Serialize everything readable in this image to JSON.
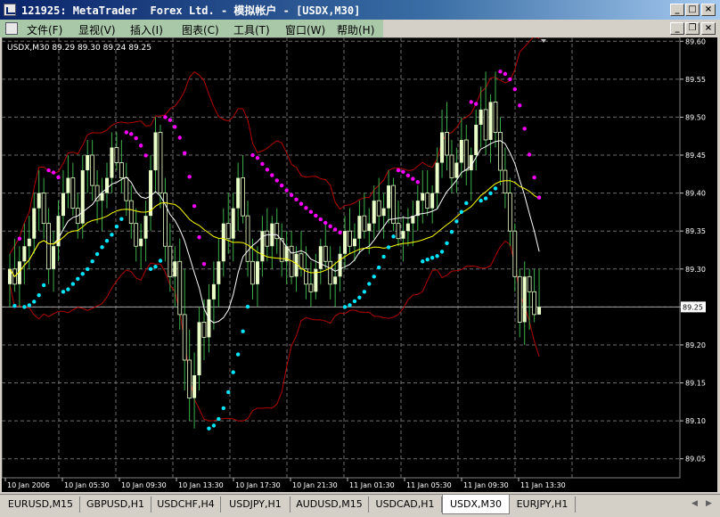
{
  "window": {
    "title": "121925: MetaTrader  Forex Ltd. - 模拟帐户 - [USDX,M30]"
  },
  "menu": {
    "items": [
      "文件(F)",
      "显视(V)",
      "插入(I)",
      "图表(C)",
      "工具(T)",
      "窗口(W)",
      "帮助(H)"
    ]
  },
  "chart": {
    "header_text": "USDX,M30  89.29 89.30 89.24 89.25",
    "current_price_label": "89.25",
    "price_axis_labels": [
      "89.60",
      "89.55",
      "89.50",
      "89.45",
      "89.40",
      "89.35",
      "89.30",
      "89.25",
      "89.20",
      "89.15",
      "89.10",
      "89.05"
    ],
    "time_axis_labels": [
      "10 Jan 2006",
      "10 Jan 05:30",
      "10 Jan 09:30",
      "10 Jan 13:30",
      "10 Jan 17:30",
      "10 Jan 21:30",
      "11 Jan 01:30",
      "11 Jan 05:30",
      "11 Jan 09:30",
      "11 Jan 13:30"
    ],
    "colors": {
      "background": "#000000",
      "grid": "#6e6e6e",
      "candle_body": "#eaffc8",
      "wick": "#3cb04a",
      "bollinger": "#b40000",
      "ma_fast": "#ffffff",
      "ma_slow": "#ffff00",
      "sar_up": "#00e6ff",
      "sar_down": "#ff00ff"
    }
  },
  "chart_data": {
    "type": "candlestick",
    "symbol": "USDX",
    "timeframe": "M30",
    "ohlc_last": {
      "open": 89.29,
      "high": 89.3,
      "low": 89.24,
      "close": 89.25
    },
    "y_range": [
      89.025,
      89.605
    ],
    "y_ticks": [
      89.6,
      89.55,
      89.5,
      89.45,
      89.4,
      89.35,
      89.3,
      89.25,
      89.2,
      89.15,
      89.1,
      89.05
    ],
    "candles": [
      [
        89.28,
        89.32,
        89.25,
        89.3
      ],
      [
        89.3,
        89.34,
        89.27,
        89.28
      ],
      [
        89.28,
        89.33,
        89.25,
        89.31
      ],
      [
        89.31,
        89.36,
        89.28,
        89.33
      ],
      [
        89.33,
        89.37,
        89.3,
        89.34
      ],
      [
        89.34,
        89.4,
        89.32,
        89.38
      ],
      [
        89.38,
        89.43,
        89.35,
        89.4
      ],
      [
        89.4,
        89.42,
        89.34,
        89.36
      ],
      [
        89.36,
        89.38,
        89.28,
        89.3
      ],
      [
        89.3,
        89.35,
        89.27,
        89.33
      ],
      [
        89.33,
        89.39,
        89.31,
        89.37
      ],
      [
        89.37,
        89.43,
        89.35,
        89.4
      ],
      [
        89.4,
        89.45,
        89.38,
        89.42
      ],
      [
        89.42,
        89.44,
        89.37,
        89.38
      ],
      [
        89.38,
        89.4,
        89.34,
        89.36
      ],
      [
        89.36,
        89.45,
        89.34,
        89.43
      ],
      [
        89.43,
        89.47,
        89.4,
        89.45
      ],
      [
        89.45,
        89.47,
        89.39,
        89.41
      ],
      [
        89.41,
        89.43,
        89.36,
        89.39
      ],
      [
        89.39,
        89.42,
        89.35,
        89.4
      ],
      [
        89.4,
        89.44,
        89.38,
        89.42
      ],
      [
        89.42,
        89.48,
        89.4,
        89.46
      ],
      [
        89.46,
        89.48,
        89.43,
        89.44
      ],
      [
        89.44,
        89.47,
        89.4,
        89.42
      ],
      [
        89.42,
        89.44,
        89.37,
        89.39
      ],
      [
        89.39,
        89.41,
        89.34,
        89.36
      ],
      [
        89.36,
        89.38,
        89.31,
        89.33
      ],
      [
        89.33,
        89.36,
        89.3,
        89.34
      ],
      [
        89.34,
        89.39,
        89.31,
        89.37
      ],
      [
        89.37,
        89.45,
        89.35,
        89.43
      ],
      [
        89.43,
        89.5,
        89.4,
        89.48
      ],
      [
        89.48,
        89.49,
        89.38,
        89.4
      ],
      [
        89.4,
        89.42,
        89.31,
        89.33
      ],
      [
        89.33,
        89.36,
        89.27,
        89.29
      ],
      [
        89.29,
        89.33,
        89.25,
        89.31
      ],
      [
        89.31,
        89.34,
        89.22,
        89.24
      ],
      [
        89.24,
        89.3,
        89.14,
        89.18
      ],
      [
        89.18,
        89.22,
        89.1,
        89.13
      ],
      [
        89.13,
        89.19,
        89.09,
        89.16
      ],
      [
        89.16,
        89.25,
        89.14,
        89.23
      ],
      [
        89.23,
        89.26,
        89.18,
        89.21
      ],
      [
        89.21,
        89.28,
        89.19,
        89.26
      ],
      [
        89.26,
        89.31,
        89.22,
        89.28
      ],
      [
        89.28,
        89.34,
        89.25,
        89.31
      ],
      [
        89.31,
        89.38,
        89.29,
        89.36
      ],
      [
        89.36,
        89.4,
        89.32,
        89.34
      ],
      [
        89.34,
        89.4,
        89.31,
        89.38
      ],
      [
        89.38,
        89.44,
        89.35,
        89.42
      ],
      [
        89.42,
        89.45,
        89.36,
        89.37
      ],
      [
        89.37,
        89.39,
        89.29,
        89.31
      ],
      [
        89.31,
        89.34,
        89.26,
        89.28
      ],
      [
        89.28,
        89.33,
        89.25,
        89.31
      ],
      [
        89.31,
        89.37,
        89.29,
        89.35
      ],
      [
        89.35,
        89.38,
        89.31,
        89.33
      ],
      [
        89.33,
        89.37,
        89.3,
        89.36
      ],
      [
        89.36,
        89.38,
        89.32,
        89.34
      ],
      [
        89.34,
        89.36,
        89.29,
        89.31
      ],
      [
        89.31,
        89.35,
        89.28,
        89.33
      ],
      [
        89.33,
        89.35,
        89.28,
        89.29
      ],
      [
        89.29,
        89.33,
        89.27,
        89.32
      ],
      [
        89.32,
        89.35,
        89.29,
        89.3
      ],
      [
        89.3,
        89.33,
        89.26,
        89.28
      ],
      [
        89.28,
        89.31,
        89.25,
        89.27
      ],
      [
        89.27,
        89.32,
        89.26,
        89.3
      ],
      [
        89.3,
        89.34,
        89.28,
        89.33
      ],
      [
        89.33,
        89.36,
        89.3,
        89.31
      ],
      [
        89.31,
        89.33,
        89.26,
        89.28
      ],
      [
        89.28,
        89.31,
        89.25,
        89.29
      ],
      [
        89.29,
        89.33,
        89.27,
        89.32
      ],
      [
        89.32,
        89.37,
        89.3,
        89.35
      ],
      [
        89.35,
        89.38,
        89.32,
        89.33
      ],
      [
        89.33,
        89.36,
        89.31,
        89.34
      ],
      [
        89.34,
        89.39,
        89.32,
        89.37
      ],
      [
        89.37,
        89.4,
        89.34,
        89.35
      ],
      [
        89.35,
        89.38,
        89.32,
        89.36
      ],
      [
        89.36,
        89.41,
        89.34,
        89.39
      ],
      [
        89.39,
        89.42,
        89.35,
        89.37
      ],
      [
        89.37,
        89.4,
        89.34,
        89.38
      ],
      [
        89.38,
        89.43,
        89.36,
        89.41
      ],
      [
        89.41,
        89.42,
        89.35,
        89.36
      ],
      [
        89.36,
        89.39,
        89.33,
        89.34
      ],
      [
        89.34,
        89.37,
        89.31,
        89.35
      ],
      [
        89.35,
        89.38,
        89.33,
        89.36
      ],
      [
        89.36,
        89.39,
        89.33,
        89.37
      ],
      [
        89.37,
        89.41,
        89.35,
        89.39
      ],
      [
        89.39,
        89.43,
        89.36,
        89.4
      ],
      [
        89.4,
        89.43,
        89.37,
        89.38
      ],
      [
        89.38,
        89.41,
        89.36,
        89.4
      ],
      [
        89.4,
        89.46,
        89.38,
        89.44
      ],
      [
        89.44,
        89.51,
        89.42,
        89.48
      ],
      [
        89.48,
        89.52,
        89.43,
        89.45
      ],
      [
        89.45,
        89.47,
        89.4,
        89.42
      ],
      [
        89.42,
        89.46,
        89.4,
        89.44
      ],
      [
        89.44,
        89.5,
        89.42,
        89.47
      ],
      [
        89.47,
        89.49,
        89.41,
        89.43
      ],
      [
        89.43,
        89.46,
        89.39,
        89.45
      ],
      [
        89.45,
        89.51,
        89.43,
        89.49
      ],
      [
        89.49,
        89.54,
        89.46,
        89.51
      ],
      [
        89.51,
        89.56,
        89.45,
        89.47
      ],
      [
        89.47,
        89.53,
        89.44,
        89.52
      ],
      [
        89.52,
        89.56,
        89.46,
        89.48
      ],
      [
        89.48,
        89.5,
        89.41,
        89.43
      ],
      [
        89.43,
        89.46,
        89.38,
        89.4
      ],
      [
        89.4,
        89.42,
        89.33,
        89.35
      ],
      [
        89.35,
        89.36,
        89.27,
        89.29
      ],
      [
        89.29,
        89.3,
        89.21,
        89.23
      ],
      [
        89.23,
        89.31,
        89.2,
        89.29
      ],
      [
        89.29,
        89.3,
        89.22,
        89.27
      ],
      [
        89.27,
        89.3,
        89.23,
        89.24
      ],
      [
        89.24,
        89.3,
        89.24,
        89.25
      ]
    ]
  },
  "tabs": [
    {
      "label": "EURUSD,M15",
      "active": false
    },
    {
      "label": "GBPUSD,H1",
      "active": false
    },
    {
      "label": "USDCHF,H4",
      "active": false
    },
    {
      "label": "USDJPY,H1",
      "active": false
    },
    {
      "label": "AUDUSD,M15",
      "active": false
    },
    {
      "label": "USDCAD,H1",
      "active": false
    },
    {
      "label": "USDX,M30",
      "active": true
    },
    {
      "label": "EURJPY,H1",
      "active": false
    }
  ]
}
